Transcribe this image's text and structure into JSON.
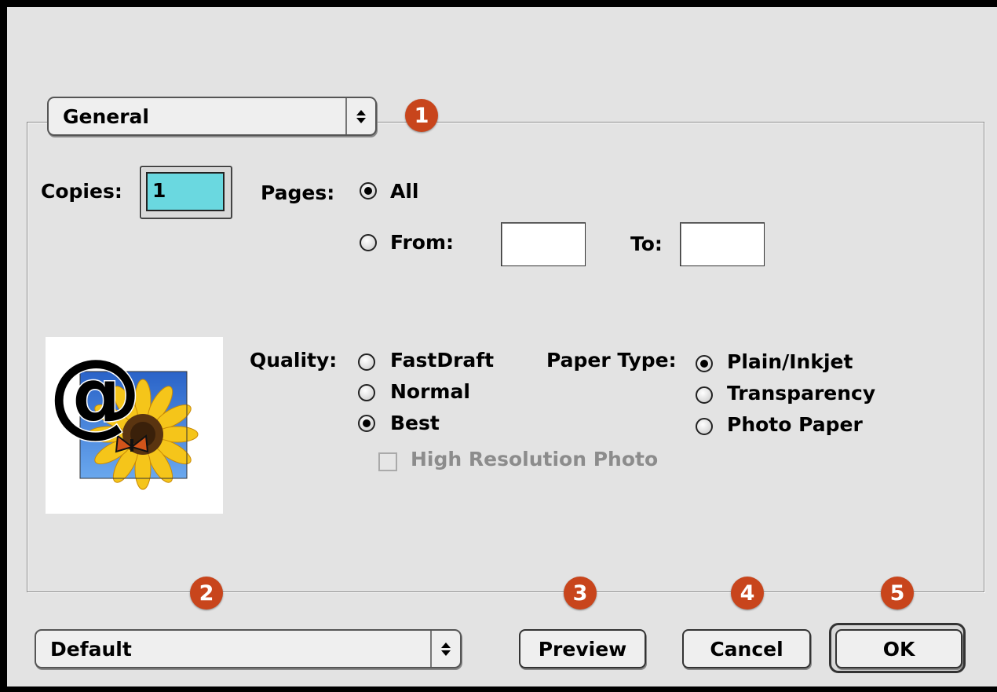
{
  "dialog": {
    "panel_menu": {
      "selected": "General"
    },
    "copies": {
      "label": "Copies:",
      "value": "1"
    },
    "pages": {
      "label": "Pages:",
      "options": [
        {
          "label": "All",
          "selected": true
        },
        {
          "label": "From:",
          "selected": false
        }
      ],
      "from_value": "",
      "to_label": "To:",
      "to_value": ""
    },
    "quality": {
      "label": "Quality:",
      "options": [
        {
          "label": "FastDraft",
          "selected": false
        },
        {
          "label": "Normal",
          "selected": false
        },
        {
          "label": "Best",
          "selected": true
        }
      ],
      "high_res": {
        "label": "High Resolution Photo",
        "checked": false,
        "enabled": false
      }
    },
    "paper_type": {
      "label": "Paper Type:",
      "options": [
        {
          "label": "Plain/Inkjet",
          "selected": true
        },
        {
          "label": "Transparency",
          "selected": false
        },
        {
          "label": "Photo Paper",
          "selected": false
        }
      ]
    },
    "settings_menu": {
      "selected": "Default"
    },
    "buttons": {
      "preview": "Preview",
      "cancel": "Cancel",
      "ok": "OK"
    },
    "callouts": [
      "1",
      "2",
      "3",
      "4",
      "5"
    ],
    "preview_image": {
      "glyph": "@"
    }
  },
  "colors": {
    "callout": "#c8451c",
    "copies_field": "#6ad8e0",
    "background": "#e3e3e3"
  },
  "icons": [
    "up-down-arrows-icon",
    "radio-button-icon",
    "checkbox-icon",
    "sunflower-butterfly-image"
  ]
}
